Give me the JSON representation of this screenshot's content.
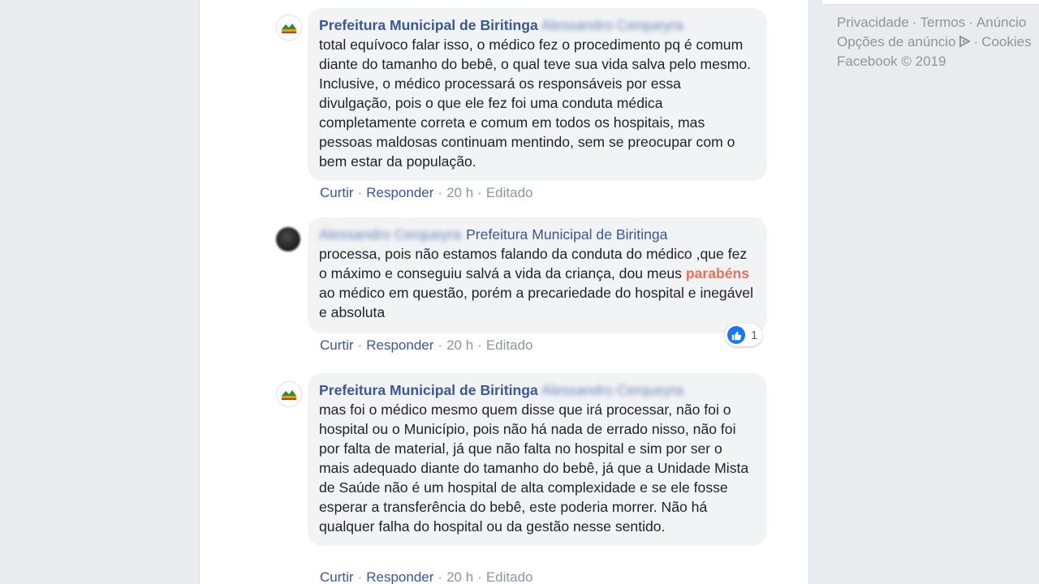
{
  "footer": {
    "links": [
      "Privacidade",
      "Termos",
      "Anúncio",
      "Opções de anúncio",
      "Cookies"
    ],
    "copyright": "Facebook © 2019"
  },
  "comments": [
    {
      "author": "Prefeitura Municipal de Biritinga",
      "mention": "Alessandro Cerqueyra",
      "text": "total equívoco falar isso, o médico fez o procedimento pq é comum diante do tamanho do bebê, o qual teve sua vida salva pelo mesmo. Inclusive, o médico processará os responsáveis por essa divulgação, pois o que ele fez foi uma conduta médica completamente correta e comum em todos os hospitais, mas pessoas maldosas continuam mentindo, sem se preocupar com o bem estar da população.",
      "actions": {
        "like": "Curtir",
        "reply": "Responder",
        "time": "20 h",
        "edited": "Editado"
      }
    },
    {
      "author": "Alessandro Cerqueyra",
      "mention": "Prefeitura Municipal de Biritinga",
      "text_before": "processa, pois não estamos falando da conduta do médico ,que fez o máximo e conseguiu salvá a vida da criança, dou meus ",
      "highlight": "parabéns",
      "text_after": " ao médico em questão, porém a precariedade do hospital e inegável e absoluta",
      "reaction_count": "1",
      "actions": {
        "like": "Curtir",
        "reply": "Responder",
        "time": "20 h",
        "edited": "Editado"
      }
    },
    {
      "author": "Prefeitura Municipal de Biritinga",
      "mention": "Alessandro Cerqueyra",
      "text": "mas foi o médico mesmo quem disse que irá processar, não foi o hospital ou o Município, pois não há nada de errado nisso, não foi por falta de material, já que não falta no hospital e sim por ser o mais adequado diante do tamanho do bebê, já que a Unidade Mista de Saúde não é um hospital de alta complexidade e se ele fosse esperar a transferência do bebê, este poderia morrer. Não há qualquer falha do hospital ou da gestão nesse sentido.",
      "actions": {
        "like": "Curtir",
        "reply": "Responder",
        "time": "20 h",
        "edited": "Editado"
      }
    }
  ],
  "colors": {
    "link": "#385898",
    "bubble": "#f2f3f5",
    "meta": "#90949c",
    "highlight": "#e9715b",
    "like": "#1877f2"
  }
}
